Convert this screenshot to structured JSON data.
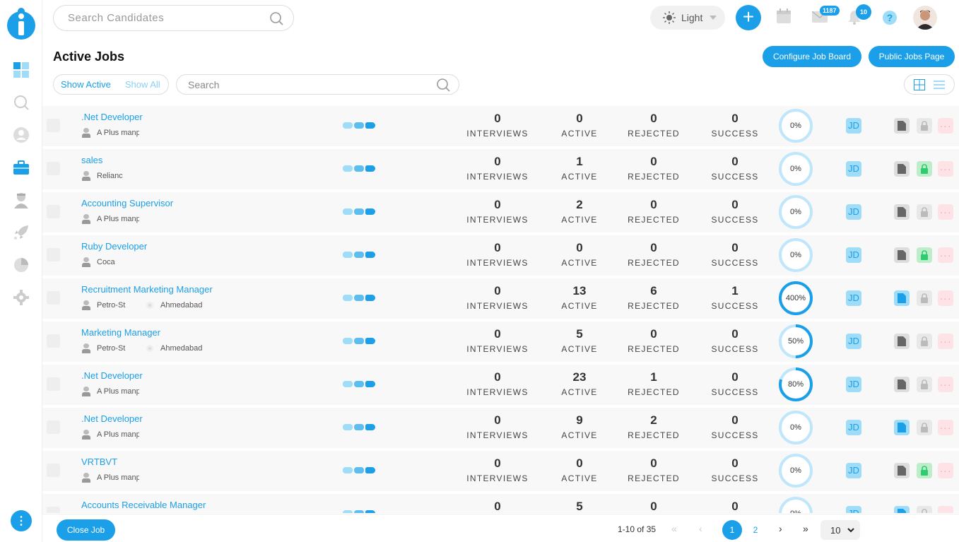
{
  "search": {
    "placeholder": "Search Candidates"
  },
  "theme": {
    "label": "Light"
  },
  "badges": {
    "mail": "1187",
    "bell": "10"
  },
  "help_label": "?",
  "page_title": "Active Jobs",
  "buttons": {
    "configure": "Configure Job Board",
    "public": "Public Jobs Page",
    "close_job": "Close Job",
    "add": "+",
    "more_vertical": "⋮"
  },
  "filter": {
    "active": "Show Active",
    "all": "Show All"
  },
  "job_search": {
    "placeholder": "Search"
  },
  "labels": {
    "interviews": "INTERVIEWS",
    "active": "ACTIVE",
    "rejected": "REJECTED",
    "success": "SUCCESS",
    "jd": "JD",
    "more": "···"
  },
  "colors": {
    "accent": "#1a9fe8",
    "accent_light": "#9fdcf7",
    "green": "#2ecc71"
  },
  "jobs": [
    {
      "title": ".Net Developer",
      "company": "A Plus manpow",
      "location": "",
      "interviews": "0",
      "active": "0",
      "rejected": "0",
      "success": "0",
      "progress_pct": 0,
      "progress_label": "0%",
      "doc": "gray",
      "lock": "gray"
    },
    {
      "title": "sales",
      "company": "Relianc",
      "location": "",
      "interviews": "0",
      "active": "1",
      "rejected": "0",
      "success": "0",
      "progress_pct": 0,
      "progress_label": "0%",
      "doc": "gray",
      "lock": "green"
    },
    {
      "title": "Accounting Supervisor",
      "company": "A Plus manpow",
      "location": "",
      "interviews": "0",
      "active": "2",
      "rejected": "0",
      "success": "0",
      "progress_pct": 0,
      "progress_label": "0%",
      "doc": "gray",
      "lock": "gray"
    },
    {
      "title": "Ruby Developer",
      "company": "Coca",
      "location": "",
      "interviews": "0",
      "active": "0",
      "rejected": "0",
      "success": "0",
      "progress_pct": 0,
      "progress_label": "0%",
      "doc": "gray",
      "lock": "green"
    },
    {
      "title": "Recruitment Marketing Manager",
      "company": "Petro-St",
      "location": "Ahmedabad",
      "interviews": "0",
      "active": "13",
      "rejected": "6",
      "success": "1",
      "progress_pct": 100,
      "progress_label": "400%",
      "doc": "blue",
      "lock": "gray"
    },
    {
      "title": "Marketing Manager",
      "company": "Petro-St",
      "location": "Ahmedabad",
      "interviews": "0",
      "active": "5",
      "rejected": "0",
      "success": "0",
      "progress_pct": 50,
      "progress_label": "50%",
      "doc": "gray",
      "lock": "gray"
    },
    {
      "title": ".Net Developer",
      "company": "A Plus manpow",
      "location": "",
      "interviews": "0",
      "active": "23",
      "rejected": "1",
      "success": "0",
      "progress_pct": 80,
      "progress_label": "80%",
      "doc": "gray",
      "lock": "gray"
    },
    {
      "title": ".Net Developer",
      "company": "A Plus manpow",
      "location": "",
      "interviews": "0",
      "active": "9",
      "rejected": "2",
      "success": "0",
      "progress_pct": 0,
      "progress_label": "0%",
      "doc": "blue",
      "lock": "gray"
    },
    {
      "title": "VRTBVT",
      "company": "A Plus manpow",
      "location": "",
      "interviews": "0",
      "active": "0",
      "rejected": "0",
      "success": "0",
      "progress_pct": 0,
      "progress_label": "0%",
      "doc": "gray",
      "lock": "green"
    },
    {
      "title": "Accounts Receivable Manager",
      "company": "",
      "location": "",
      "interviews": "0",
      "active": "5",
      "rejected": "0",
      "success": "0",
      "progress_pct": 0,
      "progress_label": "0%",
      "doc": "blue",
      "lock": "gray"
    }
  ],
  "pagination": {
    "range": "1-10 of 35",
    "pages": [
      "1",
      "2"
    ],
    "current": "1",
    "per_page": "10",
    "first": "«",
    "prev": "‹",
    "next": "›",
    "last": "»"
  }
}
